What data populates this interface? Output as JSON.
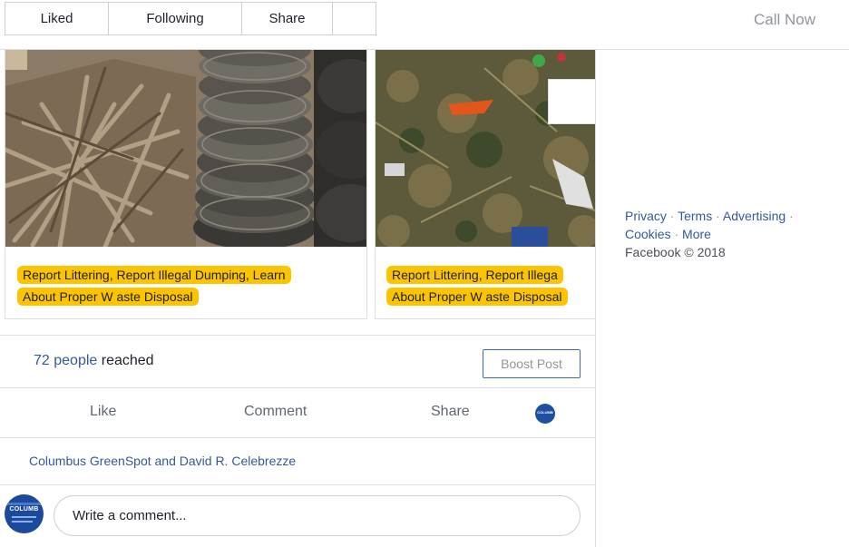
{
  "topbar": {
    "liked_label": "Liked",
    "following_label": "Following",
    "share_label": "Share",
    "more_label": "",
    "call_now_label": "Call Now"
  },
  "carousel": {
    "cards": [
      {
        "caption_line1": "Report Littering, Report Illegal Dumping, Learn",
        "caption_line2": "About Proper W  aste Disposal",
        "photo_icon": "tire-pile-photo"
      },
      {
        "caption_line1": "Report Littering, Report Illega",
        "caption_line2": "About Proper W  aste Disposal",
        "photo_icon": "litter-ground-photo"
      }
    ],
    "highlight_color": "#fcc300"
  },
  "reach": {
    "people_link": "72 people",
    "suffix": " reached",
    "boost_label": "Boost Post"
  },
  "actions": {
    "like_label": "Like",
    "comment_label": "Comment",
    "share_label": "Share"
  },
  "likers": {
    "text": "Columbus GreenSpot and David R. Celebrezze"
  },
  "comment": {
    "placeholder": "Write a comment...",
    "avatar_text": "COLUMB"
  },
  "sidebar": {
    "privacy": "Privacy",
    "terms": "Terms",
    "advertising": "Advertising",
    "cookies": "Cookies",
    "more": "More",
    "copyright": "Facebook © 2018",
    "sep": " · "
  },
  "colors": {
    "link": "#365899",
    "brand_blue": "#4267b2",
    "border": "#dddfe2"
  }
}
